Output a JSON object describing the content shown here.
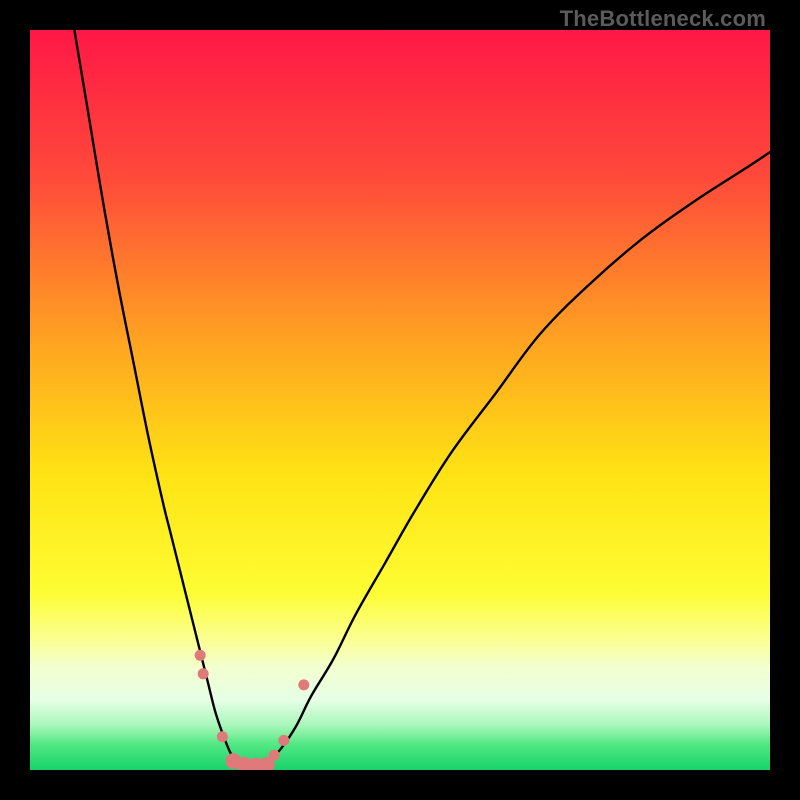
{
  "watermark": {
    "text": "TheBottleneck.com"
  },
  "chart_data": {
    "type": "line",
    "title": "",
    "xlabel": "",
    "ylabel": "",
    "xlim": [
      0,
      100
    ],
    "ylim": [
      0,
      100
    ],
    "grid": false,
    "legend": false,
    "gradient_stops": [
      {
        "offset": 0.0,
        "color": "#ff1846"
      },
      {
        "offset": 0.2,
        "color": "#ff4a3a"
      },
      {
        "offset": 0.42,
        "color": "#ffa321"
      },
      {
        "offset": 0.6,
        "color": "#ffe314"
      },
      {
        "offset": 0.76,
        "color": "#fdfd33"
      },
      {
        "offset": 0.82,
        "color": "#fbff8d"
      },
      {
        "offset": 0.86,
        "color": "#f3ffce"
      },
      {
        "offset": 0.905,
        "color": "#e6ffe6"
      },
      {
        "offset": 0.94,
        "color": "#a8f7b9"
      },
      {
        "offset": 0.965,
        "color": "#53e884"
      },
      {
        "offset": 1.0,
        "color": "#17d36a"
      }
    ],
    "series": [
      {
        "name": "left-curve",
        "color": "#000000",
        "x": [
          6,
          8,
          10,
          12,
          14,
          16,
          18,
          19,
          20,
          21,
          22,
          23,
          24,
          25,
          26,
          27,
          28
        ],
        "y": [
          100,
          88,
          76,
          65,
          55,
          45,
          36,
          32,
          28,
          24,
          20,
          16,
          12,
          8,
          5,
          2.5,
          0.8
        ]
      },
      {
        "name": "right-curve",
        "color": "#000000",
        "x": [
          32,
          34,
          36,
          38,
          41,
          44,
          48,
          52,
          57,
          63,
          69,
          76,
          83,
          90,
          97,
          100
        ],
        "y": [
          0.8,
          3,
          6,
          10,
          15,
          21,
          28,
          35,
          43,
          51,
          59,
          66,
          72,
          77,
          81.5,
          83.5
        ]
      }
    ],
    "markers": {
      "color": "#e07a7a",
      "size_small": 5.5,
      "size_large": 8,
      "points": [
        {
          "x": 23.0,
          "y": 15.5,
          "r": "small"
        },
        {
          "x": 23.4,
          "y": 13.0,
          "r": "small"
        },
        {
          "x": 26.0,
          "y": 4.5,
          "r": "small"
        },
        {
          "x": 27.5,
          "y": 1.2,
          "r": "large"
        },
        {
          "x": 29.0,
          "y": 0.7,
          "r": "large"
        },
        {
          "x": 30.5,
          "y": 0.6,
          "r": "large"
        },
        {
          "x": 32.0,
          "y": 0.7,
          "r": "large"
        },
        {
          "x": 33.0,
          "y": 2.0,
          "r": "small"
        },
        {
          "x": 34.3,
          "y": 4.0,
          "r": "small"
        },
        {
          "x": 37.0,
          "y": 11.5,
          "r": "small"
        }
      ]
    }
  }
}
